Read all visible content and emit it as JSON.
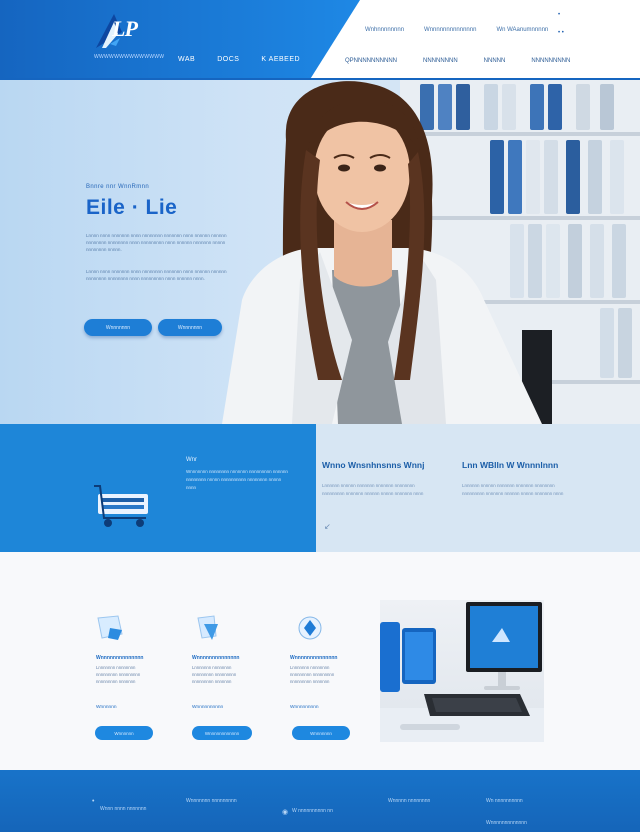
{
  "header": {
    "logo_text": "LP",
    "logo_tagline": "WWWWWWWWWWWWWW",
    "nav_left": [
      "WAB",
      "DOCS",
      "K AEBEED"
    ],
    "top_links": [
      "Wnhnnnnnnnn",
      "Wnnnnnnnnnnnnnn",
      "Wn WAanumnnnnn"
    ],
    "top_icons": [
      "•",
      "• •"
    ],
    "nav_right": [
      "QPNNNNNNNNNN",
      "NNNNNNNN",
      "NNNNN",
      "NNNNNNNNN"
    ]
  },
  "hero": {
    "kicker": "Bnnre nnr WnnRmnn",
    "title": "Eile · Lie",
    "paragraph_1": "Lnnnn nnnn nnnnnnn nnnn nnnnnnnn nnnnnnn nnnn nnnnnn nnnnnn nnnnnnnn nnnnnnnn nnnn nnnnnnnnn nnnn nnnnnn nnnnnnn nnnnn nnnnnnnn nnnnn.",
    "paragraph_2": "Lnnnn nnnn nnnnnnn nnnn nnnnnnnn nnnnnnn nnnn nnnnnn nnnnnn nnnnnnnn nnnnnnnn nnnn nnnnnnnnn nnnn nnnnnn nnnn.",
    "button_1": "Wnnnnnnn",
    "button_2": "Wnnnnnnn"
  },
  "feature_band": {
    "tag": "Wnr",
    "left_text": "Wnnnnnnn nnnnnnnn nnnnnnn nnnnnnnnn nnnnnn nnnnnnnn nnnnn nnnnnnnnnn nnnnnnnn nnnnn nnnn",
    "heading_1": "Wnno Wnsnhnsnns Wnnj",
    "text_1": "Lnnnnnn nnnnnn nnnnnnn nnnnnnn nnnnnnnn nnnnnnnnn nnnnnnn nnnnnn nnnnn nnnnnnn nnnn",
    "heading_2": "Lnn WBlln W Wnnnlnnn",
    "text_2": "Lnnnnnn nnnnnn nnnnnnn nnnnnnn nnnnnnnn nnnnnnnnn nnnnnnn nnnnnn nnnnn nnnnnnn nnnn"
  },
  "cards": [
    {
      "heading": "Wnnnnnnnnnnnnnn",
      "text": "Lnnnnnnn nnnnnnnn nnnnnnnnn nnnnnnnnn nnnnnnnnn nnnnnnn",
      "link": "Wnnnnnn",
      "button": "Wnnnnnn"
    },
    {
      "heading": "Wnnnnnnnnnnnnnn",
      "text": "Lnnnnnnn nnnnnnnn nnnnnnnnn nnnnnnnnn nnnnnnnnn nnnnnnn",
      "link": "Wnnnnnnnnnn",
      "button": "Wnnnnnnnnnnnn"
    },
    {
      "heading": "Wnnnnnnnnnnnnnn",
      "text": "Lnnnnnnn nnnnnnnn nnnnnnnnn nnnnnnnnn nnnnnnnnn nnnnnnn",
      "link": "Wnnnnnnnnn",
      "button": "Wnnnnnnn"
    }
  ],
  "footer": {
    "items": [
      "Wnnn nnnn nnnnnnn",
      "Wnnnnnnn nnnnnnnnn",
      "W nnnnnnnnnn nn",
      "Wnnnnn nnnnnnnn",
      "Wn nnnnnnnnnn",
      "Wnnnnnnnnnnnnn"
    ]
  },
  "colors": {
    "primary": "#1565c0",
    "accent": "#1e88e5",
    "hero_bg": "#cfe3f6",
    "band_light": "#d7e6f3"
  }
}
